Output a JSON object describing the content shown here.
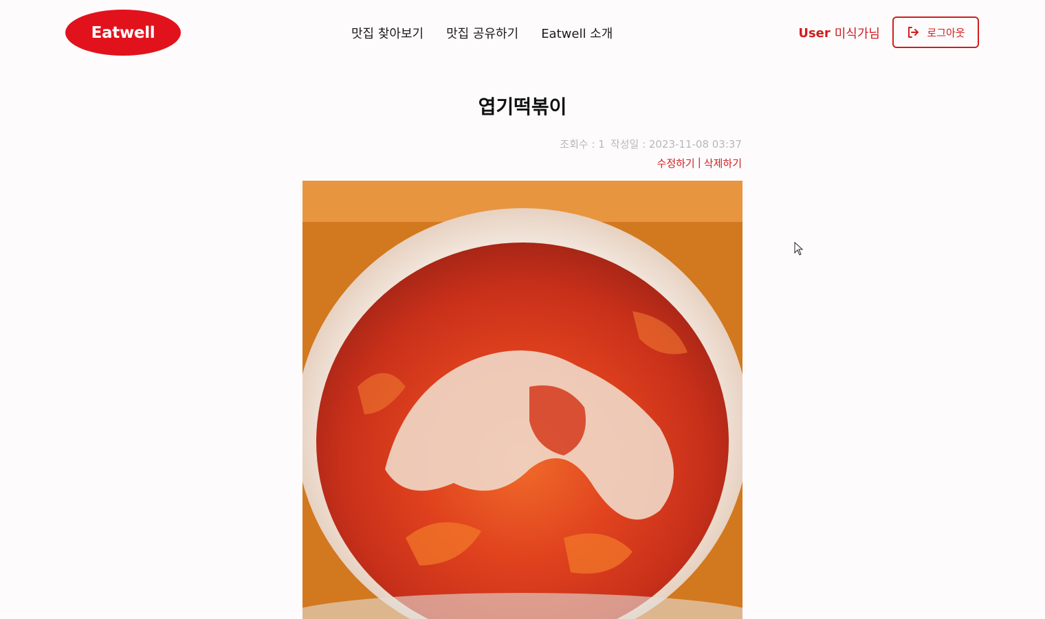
{
  "header": {
    "logo_text": "Eatwell",
    "nav": [
      {
        "label": "맛집 찾아보기"
      },
      {
        "label": "맛집 공유하기"
      },
      {
        "label": "Eatwell 소개"
      }
    ],
    "user_name": "User",
    "user_suffix": "미식가님",
    "logout_label": "로그아웃",
    "logout_icon": "logout-icon"
  },
  "post": {
    "title": "엽기떡볶이",
    "views_label": "조회수 : 1",
    "date_label": "작성일 : 2023-11-08 03:37",
    "edit_label": "수정하기",
    "separator": "|",
    "delete_label": "삭제하기",
    "photo_description": "tteokbokki-photo"
  },
  "colors": {
    "brand_red": "#e2121c",
    "accent_red": "#d01d1d",
    "meta_gray": "#b8b8b8",
    "background": "#fdfbfc"
  }
}
